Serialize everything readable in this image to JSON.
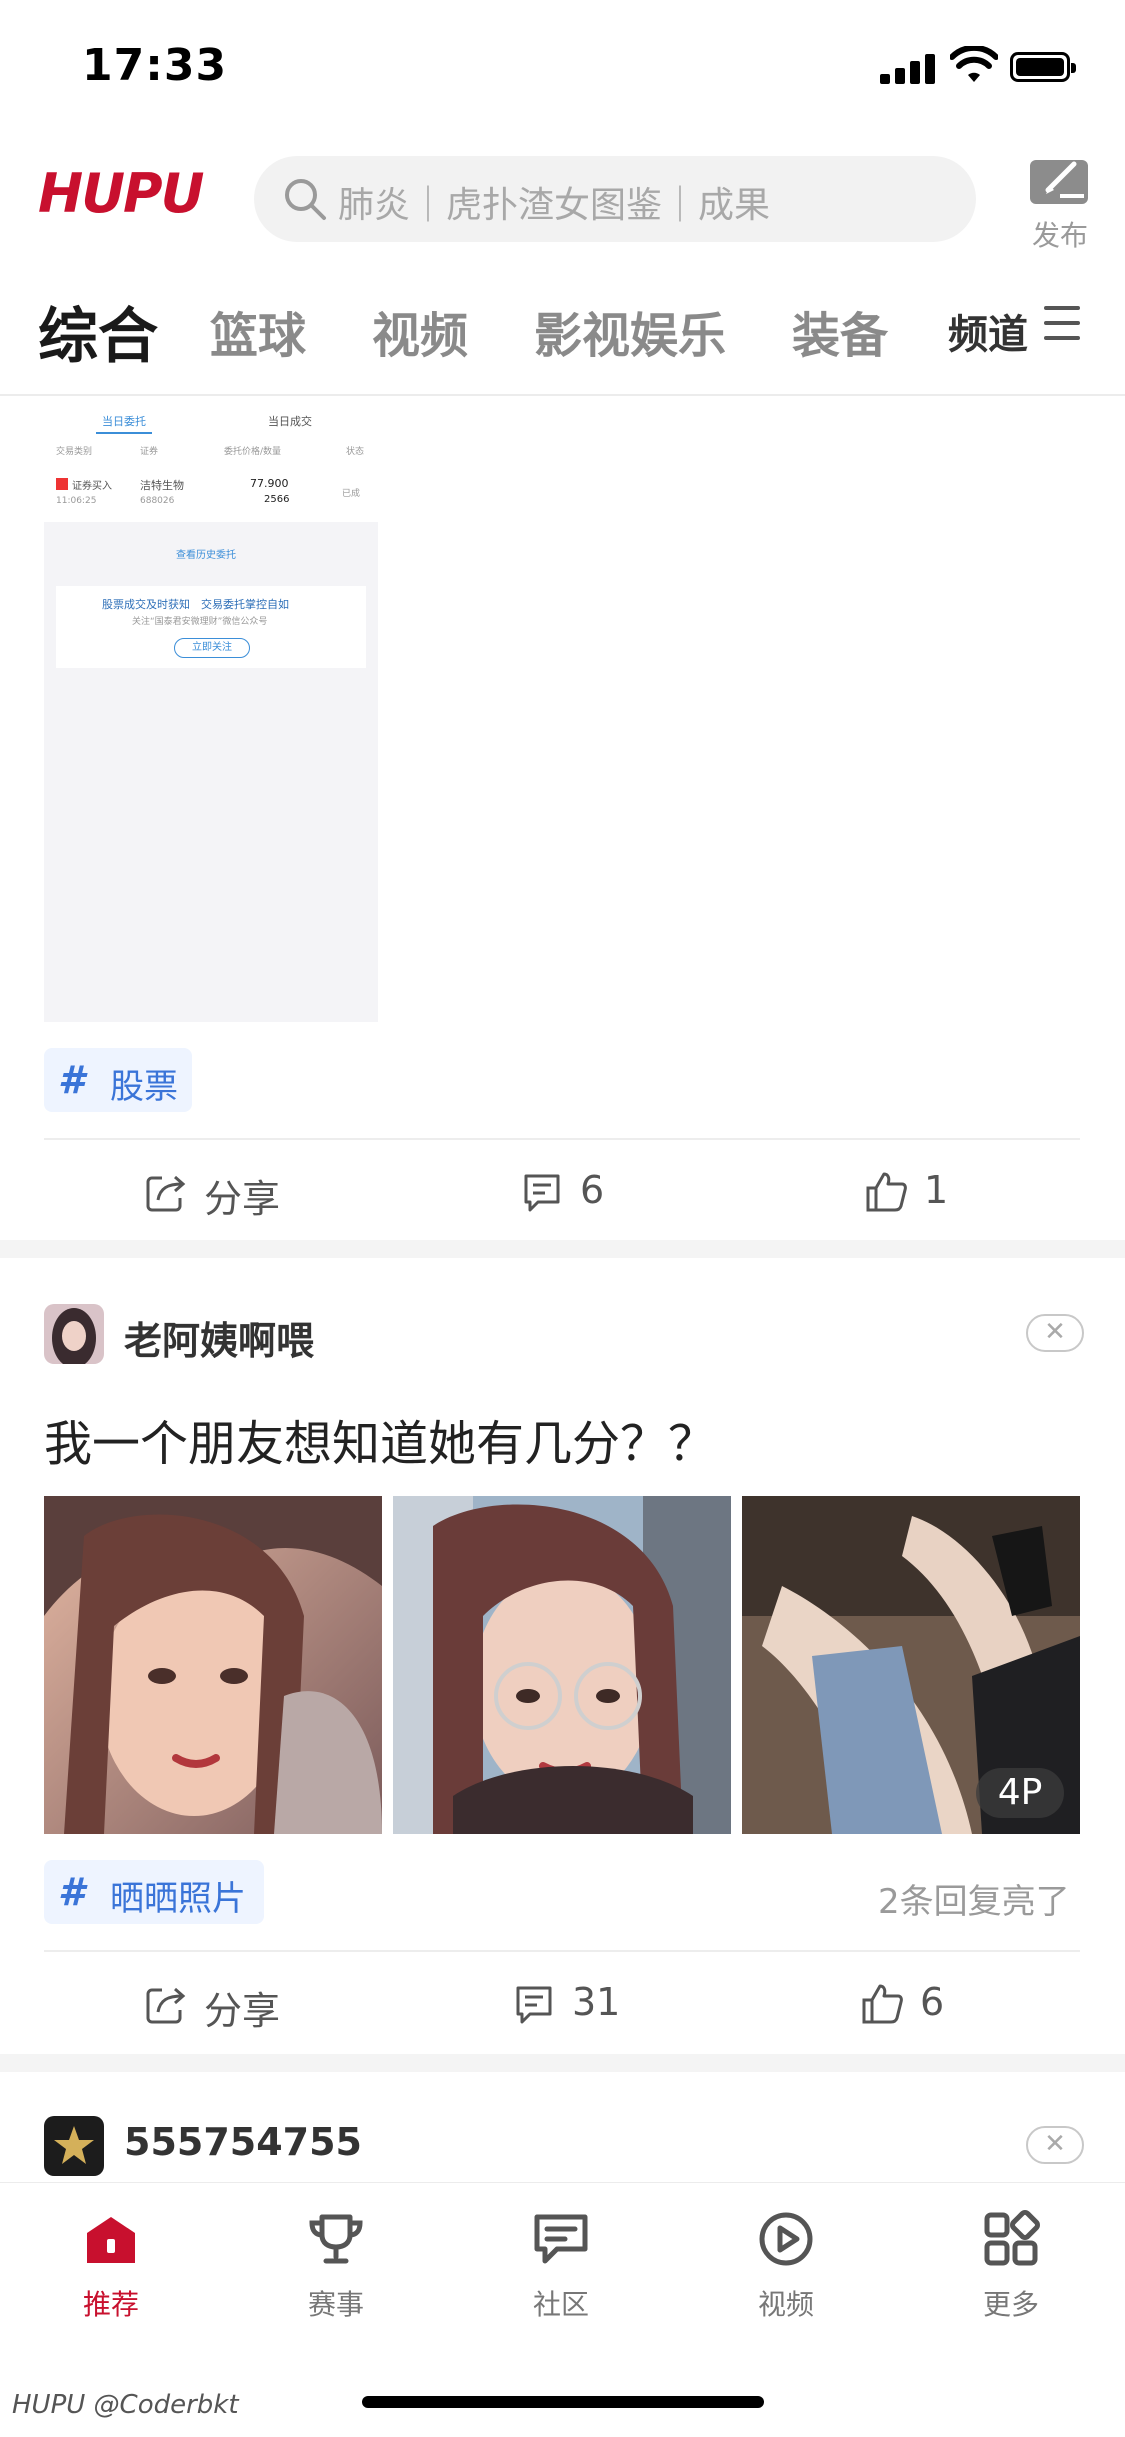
{
  "status_bar": {
    "time": "17:33"
  },
  "header": {
    "logo_text": "HUPU",
    "search_placeholder": "肺炎｜虎扑渣女图鉴｜成果",
    "publish_label": "发布"
  },
  "tabs": [
    {
      "label": "综合",
      "active": true
    },
    {
      "label": "篮球",
      "active": false
    },
    {
      "label": "视频",
      "active": false
    },
    {
      "label": "影视娱乐",
      "active": false
    },
    {
      "label": "装备",
      "active": false
    }
  ],
  "channel_label": "频道",
  "post1": {
    "screenshot": {
      "tab_today_orders": "当日委托",
      "tab_today_deals": "当日成交",
      "columns": [
        "交易类别",
        "证券",
        "委托价格/数量",
        "状态"
      ],
      "row": {
        "type": "证券买入",
        "time": "11:06:25",
        "stock_name": "洁特生物",
        "stock_code": "688026",
        "price": "77.900",
        "quantity": "2566",
        "status": "已成"
      },
      "history_link": "查看历史委托",
      "promo_title": "股票成交及时获知　交易委托掌控自如",
      "promo_sub": "关注“国泰君安微理财”微信公众号",
      "promo_button": "立即关注"
    },
    "topic": "股票",
    "share_label": "分享",
    "comments": "6",
    "likes": "1"
  },
  "post2": {
    "author": "老阿姨啊喂",
    "title": "我一个朋友想知道她有几分？？",
    "photo_count": "4P",
    "topic": "晒晒照片",
    "reply_hint": "2条回复亮了",
    "share_label": "分享",
    "comments": "31",
    "likes": "6"
  },
  "post3": {
    "author": "555754755"
  },
  "bottom_nav": [
    {
      "label": "推荐",
      "icon": "home-icon",
      "active": true
    },
    {
      "label": "赛事",
      "icon": "trophy-icon",
      "active": false
    },
    {
      "label": "社区",
      "icon": "chat-icon",
      "active": false
    },
    {
      "label": "视频",
      "icon": "play-icon",
      "active": false
    },
    {
      "label": "更多",
      "icon": "grid-icon",
      "active": false
    }
  ],
  "watermark": "HUPU @Coderbkt",
  "colors": {
    "brand": "#c8102e",
    "topic": "#3a74d8"
  }
}
